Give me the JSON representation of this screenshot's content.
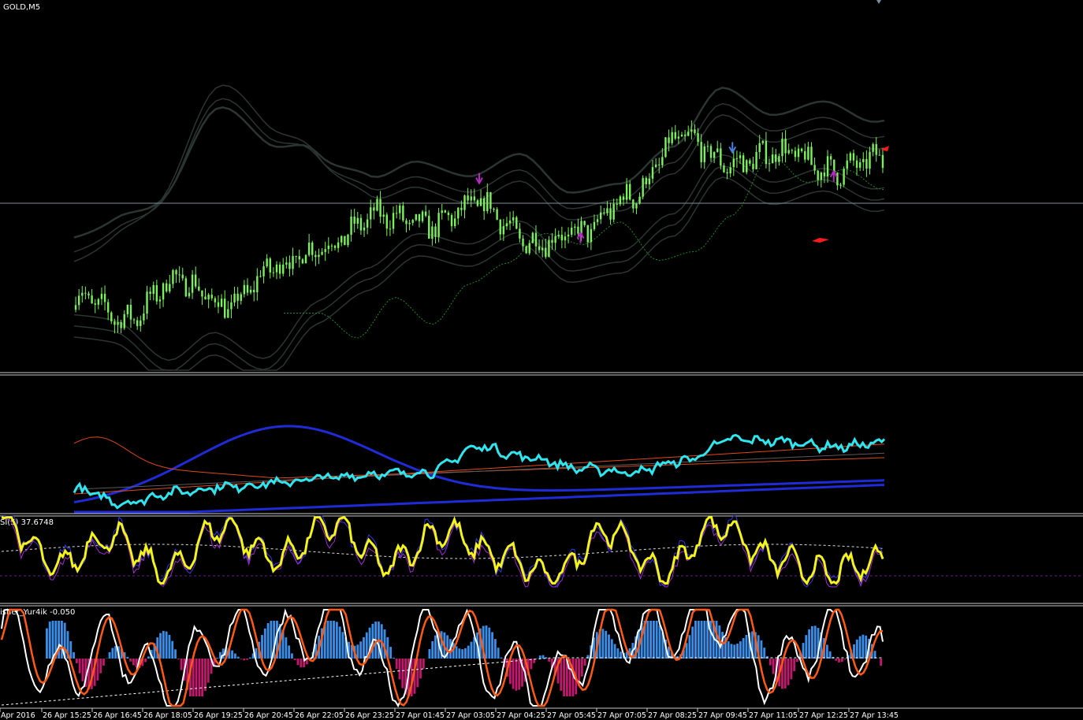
{
  "window": {
    "title": "GOLD,M5"
  },
  "colors": {
    "background": "#000000",
    "bull_candle": "#7cf25a",
    "envelope": "#2b3531",
    "price_line": "#7f8f99",
    "ma_dotted": "#1f8a1f",
    "rsi_cyan": "#2ee6f0",
    "band_blue": "#1f2bd6",
    "band_orange": "#e0481d",
    "rsi_yellow": "#f4f41a",
    "fisher_up": "#3b8ee8",
    "fisher_down": "#c0186c",
    "fisher_white": "#ffffff",
    "fisher_orange": "#ff5a14",
    "arrow_blue": "#4a7fe0",
    "arrow_magenta": "#b62ac3",
    "arrow_red": "#ff1a1a"
  },
  "panes": [
    {
      "id": "price",
      "label": ""
    },
    {
      "id": "rsi-bands",
      "label": ""
    },
    {
      "id": "rsi",
      "label": "SI(5) 37.6748"
    },
    {
      "id": "fisher",
      "label": "isher_Yur4ik -0.050"
    }
  ],
  "time_axis": [
    "Apr 2016",
    "26 Apr 15:25",
    "26 Apr 16:45",
    "26 Apr 18:05",
    "26 Apr 19:25",
    "26 Apr 20:45",
    "26 Apr 22:05",
    "26 Apr 23:25",
    "27 Apr 01:45",
    "27 Apr 03:05",
    "27 Apr 04:25",
    "27 Apr 05:45",
    "27 Apr 07:05",
    "27 Apr 08:25",
    "27 Apr 09:45",
    "27 Apr 11:05",
    "27 Apr 12:25",
    "27 Apr 13:45"
  ],
  "chart_data": [
    {
      "type": "line",
      "title": "GOLD,M5",
      "x": [
        "26 Apr 15:25",
        "26 Apr 16:45",
        "26 Apr 18:05",
        "26 Apr 19:25",
        "26 Apr 20:45",
        "26 Apr 22:05",
        "26 Apr 23:25",
        "27 Apr 01:45",
        "27 Apr 03:05",
        "27 Apr 04:25",
        "27 Apr 05:45",
        "27 Apr 07:05",
        "27 Apr 08:25",
        "27 Apr 09:45",
        "27 Apr 11:05",
        "27 Apr 12:25",
        "27 Apr 13:45"
      ],
      "series": [
        {
          "values": [
            0.33,
            0.22,
            0.4,
            0.28,
            0.46,
            0.55,
            0.68,
            0.63,
            0.73,
            0.56,
            0.6,
            0.76,
            1.02,
            0.9,
            0.96,
            0.87,
            0.93
          ]
        }
      ],
      "markers": [
        {
          "type": "down-arrow",
          "x": "27 Apr 03:05"
        },
        {
          "type": "up-arrow",
          "x": "27 Apr 05:45"
        },
        {
          "type": "down-arrow",
          "x": "27 Apr 09:45"
        },
        {
          "type": "up-arrow",
          "x": "27 Apr 12:25"
        }
      ]
    },
    {
      "type": "line",
      "x": [
        "26 Apr 15:25",
        "26 Apr 16:45",
        "26 Apr 18:05",
        "26 Apr 19:25",
        "26 Apr 20:45",
        "26 Apr 22:05",
        "26 Apr 23:25",
        "27 Apr 01:45",
        "27 Apr 03:05",
        "27 Apr 04:25",
        "27 Apr 05:45",
        "27 Apr 07:05",
        "27 Apr 08:25",
        "27 Apr 09:45",
        "27 Apr 11:05",
        "27 Apr 12:25",
        "27 Apr 13:45"
      ],
      "series": [
        {
          "values": [
            0.25,
            0.1,
            0.22,
            0.28,
            0.32,
            0.38,
            0.42,
            0.44,
            0.72,
            0.6,
            0.48,
            0.44,
            0.56,
            0.8,
            0.78,
            0.72,
            0.76
          ]
        }
      ]
    },
    {
      "type": "line",
      "title": "SI(5) 37.6748",
      "x": [
        "26 Apr 15:25",
        "26 Apr 16:45",
        "26 Apr 18:05",
        "26 Apr 19:25",
        "26 Apr 20:45",
        "26 Apr 22:05",
        "26 Apr 23:25",
        "27 Apr 01:45",
        "27 Apr 03:05",
        "27 Apr 04:25",
        "27 Apr 05:45",
        "27 Apr 07:05",
        "27 Apr 08:25",
        "27 Apr 09:45",
        "27 Apr 11:05",
        "27 Apr 12:25",
        "27 Apr 13:45"
      ],
      "series": [
        {
          "values": [
            95,
            30,
            70,
            22,
            85,
            40,
            88,
            32,
            78,
            45,
            15,
            80,
            20,
            88,
            40,
            20,
            38
          ]
        }
      ]
    },
    {
      "type": "bar",
      "title": "isher_Yur4ik -0.050",
      "x": [
        "26 Apr 15:25",
        "26 Apr 16:45",
        "26 Apr 18:05",
        "26 Apr 19:25",
        "26 Apr 20:45",
        "26 Apr 22:05",
        "26 Apr 23:25",
        "27 Apr 01:45",
        "27 Apr 03:05",
        "27 Apr 04:25",
        "27 Apr 05:45",
        "27 Apr 07:05",
        "27 Apr 08:25",
        "27 Apr 09:45",
        "27 Apr 11:05",
        "27 Apr 12:25",
        "27 Apr 13:45"
      ],
      "values": [
        0.8,
        -0.4,
        0.4,
        -0.7,
        0.6,
        0.3,
        0.9,
        -0.5,
        0.8,
        -0.3,
        -0.6,
        0.7,
        0.6,
        1.0,
        -0.3,
        0.5,
        -0.05
      ]
    }
  ]
}
